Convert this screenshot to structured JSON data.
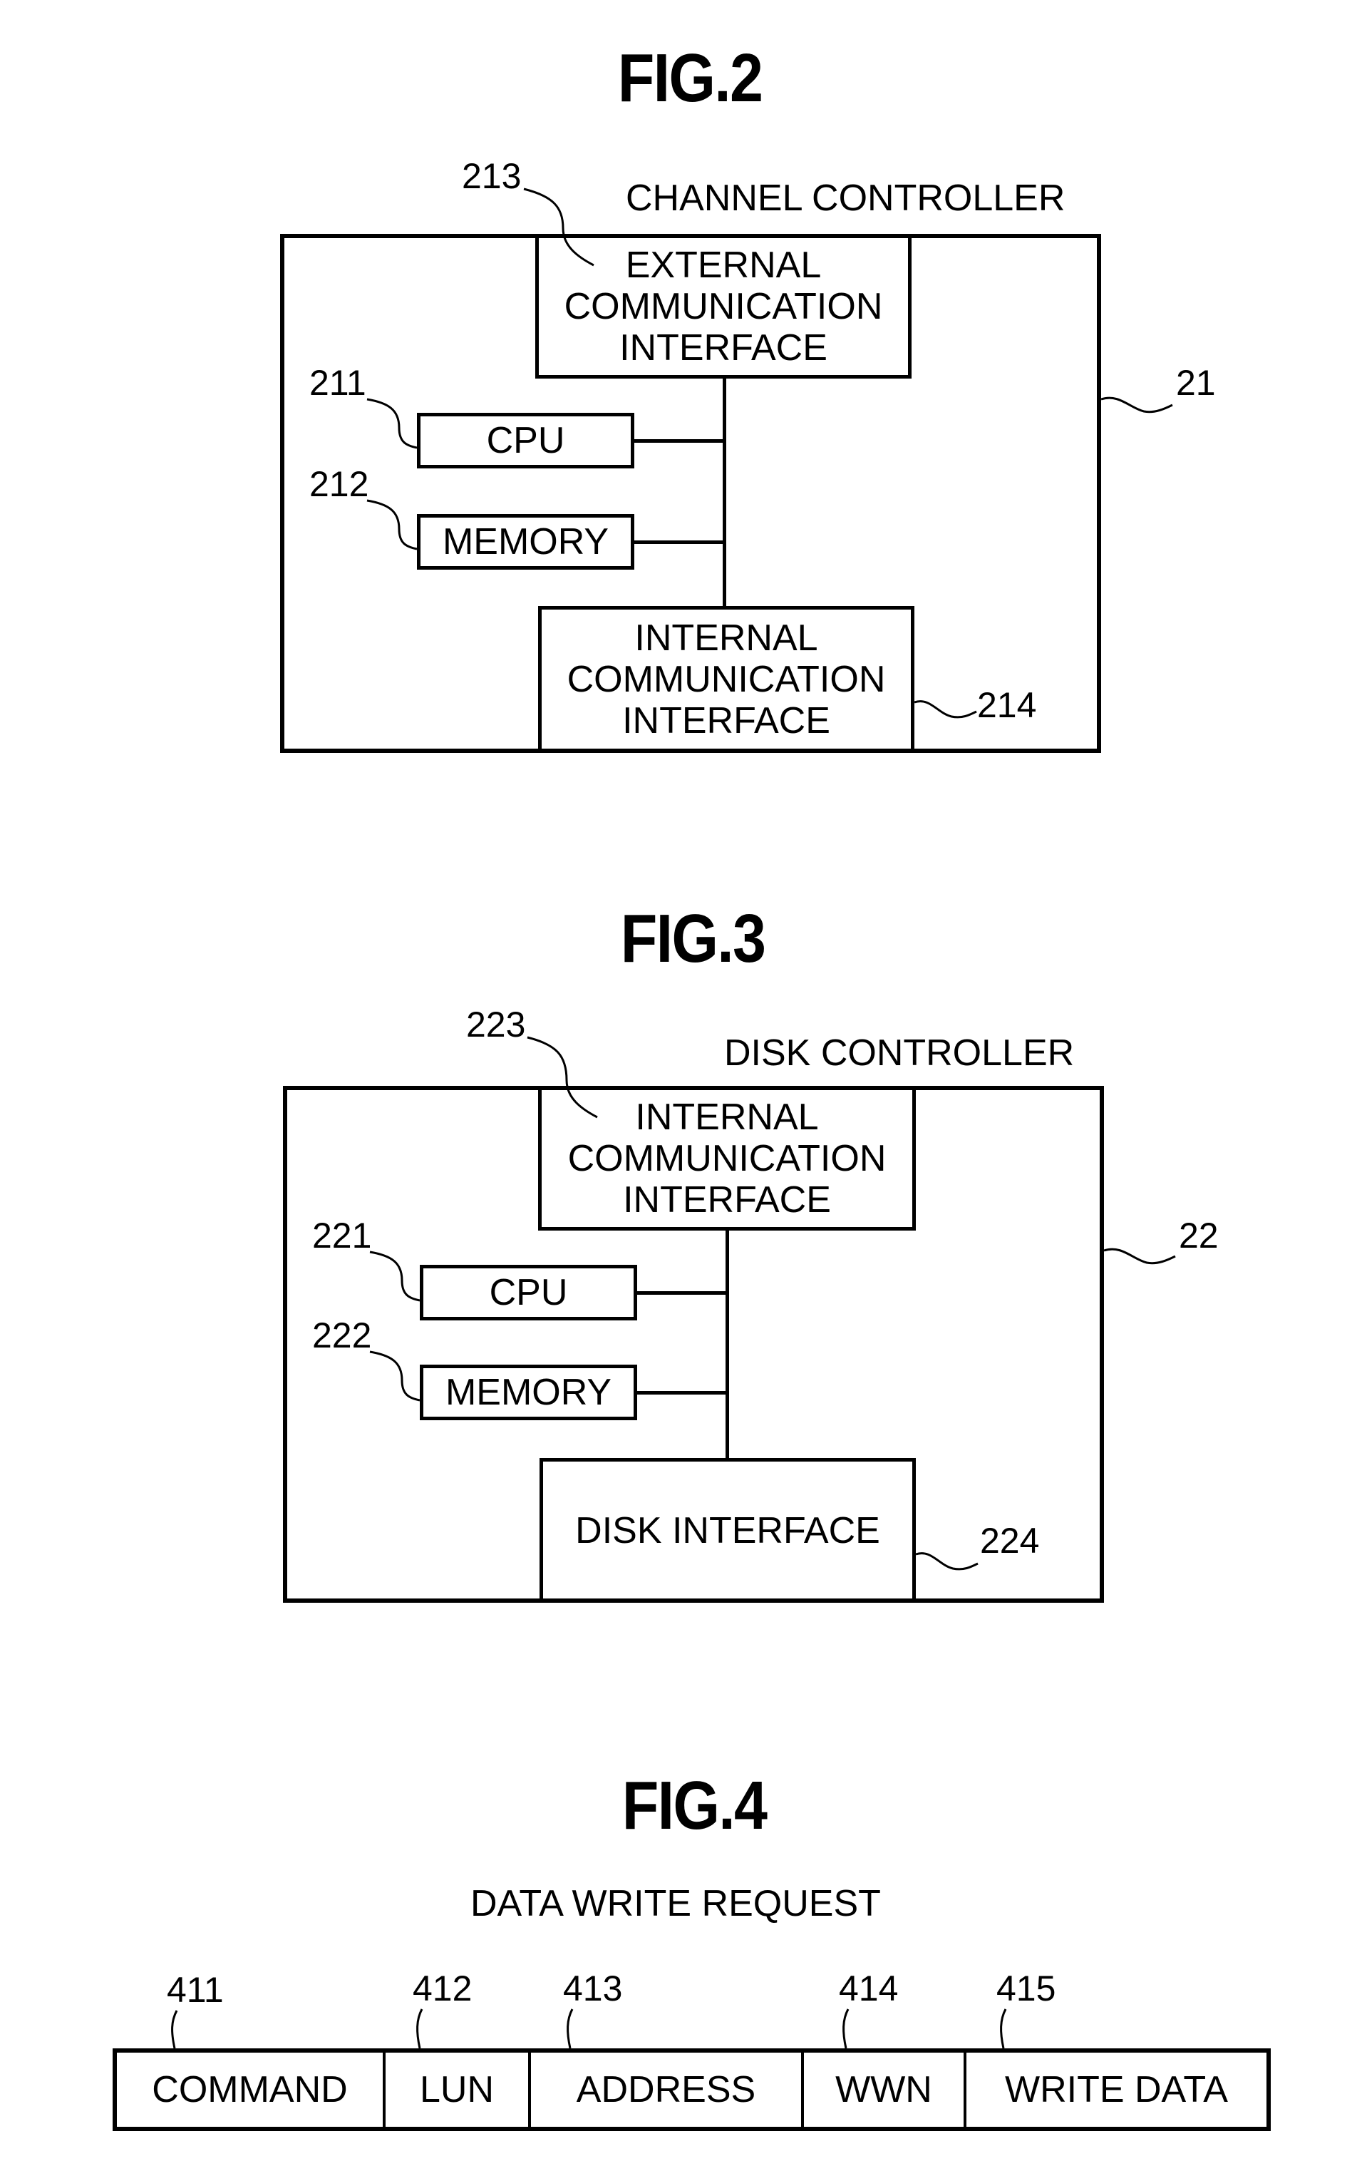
{
  "figures": {
    "fig2": {
      "title": "FIG.2",
      "caption": "CHANNEL CONTROLLER",
      "ref_main": "21",
      "blocks": {
        "external_interface": {
          "ref": "213",
          "lines": [
            "EXTERNAL",
            "COMMUNICATION",
            "INTERFACE"
          ]
        },
        "cpu": {
          "ref": "211",
          "label": "CPU"
        },
        "memory": {
          "ref": "212",
          "label": "MEMORY"
        },
        "internal_interface": {
          "ref": "214",
          "lines": [
            "INTERNAL",
            "COMMUNICATION",
            "INTERFACE"
          ]
        }
      }
    },
    "fig3": {
      "title": "FIG.3",
      "caption": "DISK CONTROLLER",
      "ref_main": "22",
      "blocks": {
        "internal_interface": {
          "ref": "223",
          "lines": [
            "INTERNAL",
            "COMMUNICATION",
            "INTERFACE"
          ]
        },
        "cpu": {
          "ref": "221",
          "label": "CPU"
        },
        "memory": {
          "ref": "222",
          "label": "MEMORY"
        },
        "disk_interface": {
          "ref": "224",
          "label": "DISK INTERFACE"
        }
      }
    },
    "fig4": {
      "title": "FIG.4",
      "caption": "DATA WRITE REQUEST",
      "fields": [
        {
          "ref": "411",
          "label": "COMMAND"
        },
        {
          "ref": "412",
          "label": "LUN"
        },
        {
          "ref": "413",
          "label": "ADDRESS"
        },
        {
          "ref": "414",
          "label": "WWN"
        },
        {
          "ref": "415",
          "label": "WRITE DATA"
        }
      ]
    }
  }
}
